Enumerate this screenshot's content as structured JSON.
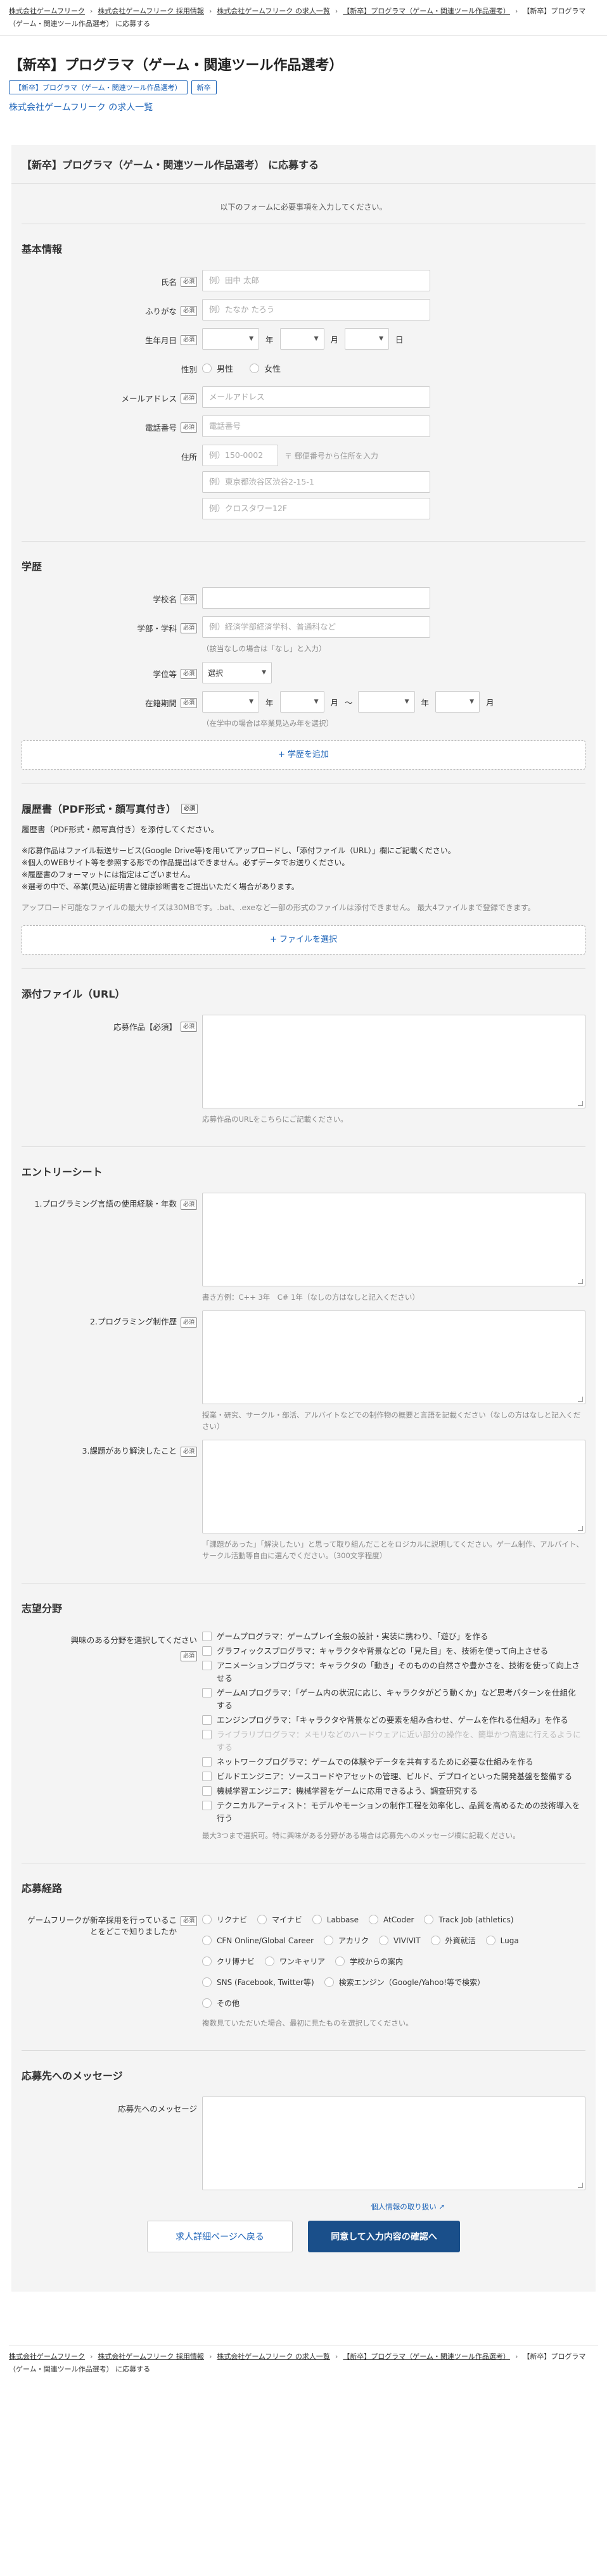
{
  "breadcrumb": [
    "株式会社ゲームフリーク",
    "株式会社ゲームフリーク 採用情報",
    "株式会社ゲームフリーク の求人一覧",
    "【新卒】プログラマ（ゲーム・関連ツール作品選考）",
    "【新卒】プログラマ（ゲーム・関連ツール作品選考） に応募する"
  ],
  "job": {
    "title": "【新卒】プログラマ（ゲーム・関連ツール作品選考）",
    "tag_title": "【新卒】プログラマ（ゲーム・関連ツール作品選考）",
    "tag_new": "新卒",
    "company_link": "株式会社ゲームフリーク の求人一覧"
  },
  "form": {
    "heading": "【新卒】プログラマ（ゲーム・関連ツール作品選考） に応募する",
    "intro": "以下のフォームに必要事項を入力してください。",
    "required": "必須",
    "basic": {
      "title": "基本情報",
      "name_label": "氏名",
      "name_ph": "例）田中 太郎",
      "kana_label": "ふりがな",
      "kana_ph": "例）たなか たろう",
      "birth_label": "生年月日",
      "year": "年",
      "month": "月",
      "day": "日",
      "gender_label": "性別",
      "male": "男性",
      "female": "女性",
      "email_label": "メールアドレス",
      "email_ph": "メールアドレス",
      "phone_label": "電話番号",
      "phone_ph": "電話番号",
      "address_label": "住所",
      "zip_ph": "例）150-0002",
      "zip_help": "〒 郵便番号から住所を入力",
      "addr1_ph": "例）東京都渋谷区渋谷2-15-1",
      "addr2_ph": "例）クロスタワー12F"
    },
    "edu": {
      "title": "学歴",
      "school_label": "学校名",
      "faculty_label": "学部・学科",
      "faculty_ph": "例）経済学部経済学科、普通科など",
      "faculty_help": "（該当なしの場合は「なし」と入力）",
      "status_label": "学位等",
      "status_value": "選択",
      "period_label": "在籍期間",
      "year": "年",
      "month": "月",
      "tilde": "〜",
      "period_help": "（在学中の場合は卒業見込み年を選択）",
      "add_button": "+ 学歴を追加"
    },
    "resume": {
      "title": "履歴書（PDF形式・顔写真付き）",
      "desc": "履歴書（PDF形式・顔写真付き）を添付してください。",
      "notes": [
        "※応募作品はファイル転送サービス(Google Drive等)を用いてアップロードし、「添付ファイル（URL）」欄にご記載ください。",
        "※個人のWEBサイト等を参照する形での作品提出はできません。必ずデータでお送りください。",
        "※履歴書のフォーマットには指定はございません。",
        "※選考の中で、卒業(見込)証明書と健康診断書をご提出いただく場合があります。"
      ],
      "limit": "アップロード可能なファイルの最大サイズは30MBです。.bat、.exeなど一部の形式のファイルは添付できません。 最大4ファイルまで登録できます。",
      "select_button": "+ ファイルを選択"
    },
    "attach": {
      "title": "添付ファイル（URL）",
      "label": "応募作品【必須】",
      "help": "応募作品のURLをこちらにご記載ください。"
    },
    "entry": {
      "title": "エントリーシート",
      "q1": "1.プログラミング言語の使用経験・年数",
      "q1_help": "書き方例：C++ 3年　C# 1年（なしの方はなしと記入ください）",
      "q2": "2.プログラミング制作歴",
      "q2_help": "授業・研究、サークル・部活、アルバイトなどでの制作物の概要と言語を記載ください（なしの方はなしと記入ください）",
      "q3": "3.課題があり解決したこと",
      "q3_help": "「課題があった」「解決したい」と思って取り組んだことをロジカルに説明してください。ゲーム制作、アルバイト、サークル活動等自由に選んでください。（300文字程度）"
    },
    "interest": {
      "title": "志望分野",
      "label": "興味のある分野を選択してください",
      "options": [
        "ゲームプログラマ：ゲームプレイ全般の設計・実装に携わり、「遊び」を作る",
        "グラフィックスプログラマ：キャラクタや背景などの「見た目」を、技術を使って向上させる",
        "アニメーションプログラマ：キャラクタの「動き」そのものの自然さや豊かさを、技術を使って向上させる",
        "ゲームAIプログラマ：「ゲーム内の状況に応じ、キャラクタがどう動くか」など思考パターンを仕組化する",
        "エンジンプログラマ：「キャラクタや背景などの要素を組み合わせ、ゲームを作れる仕組み」を作る",
        "ライブラリプログラマ：メモリなどのハードウェアに近い部分の操作を、簡単かつ高速に行えるようにする",
        "ネットワークプログラマ：ゲームでの体験やデータを共有するために必要な仕組みを作る",
        "ビルドエンジニア：ソースコードやアセットの管理、ビルド、デプロイといった開発基盤を整備する",
        "機械学習エンジニア：機械学習をゲームに応用できるよう、調査研究する",
        "テクニカルアーティスト：モデルやモーションの制作工程を効率化し、品質を高めるための技術導入を行う"
      ],
      "disabled_index": 5,
      "help": "最大3つまで選択可。特に興味がある分野がある場合は応募先へのメッセージ欄に記載ください。"
    },
    "source": {
      "title": "応募経路",
      "label": "ゲームフリークが新卒採用を行っていることをどこで知りましたか",
      "options": [
        "リクナビ",
        "マイナビ",
        "Labbase",
        "AtCoder",
        "Track Job (athletics)",
        "CFN Online/Global Career",
        "アカリク",
        "VIVIVIT",
        "外資就活",
        "Luga",
        "クリ博ナビ",
        "ワンキャリア",
        "学校からの案内",
        "SNS (Facebook, Twitter等)",
        "検索エンジン（Google/Yahoo!等で検索）",
        "その他"
      ],
      "help": "複数見ていただいた場合、最初に見たものを選択してください。"
    },
    "message": {
      "title": "応募先へのメッセージ",
      "label": "応募先へのメッセージ"
    },
    "privacy": "個人情報の取り扱い",
    "back_button": "求人詳細ページへ戻る",
    "submit_button": "同意して入力内容の確認へ"
  }
}
